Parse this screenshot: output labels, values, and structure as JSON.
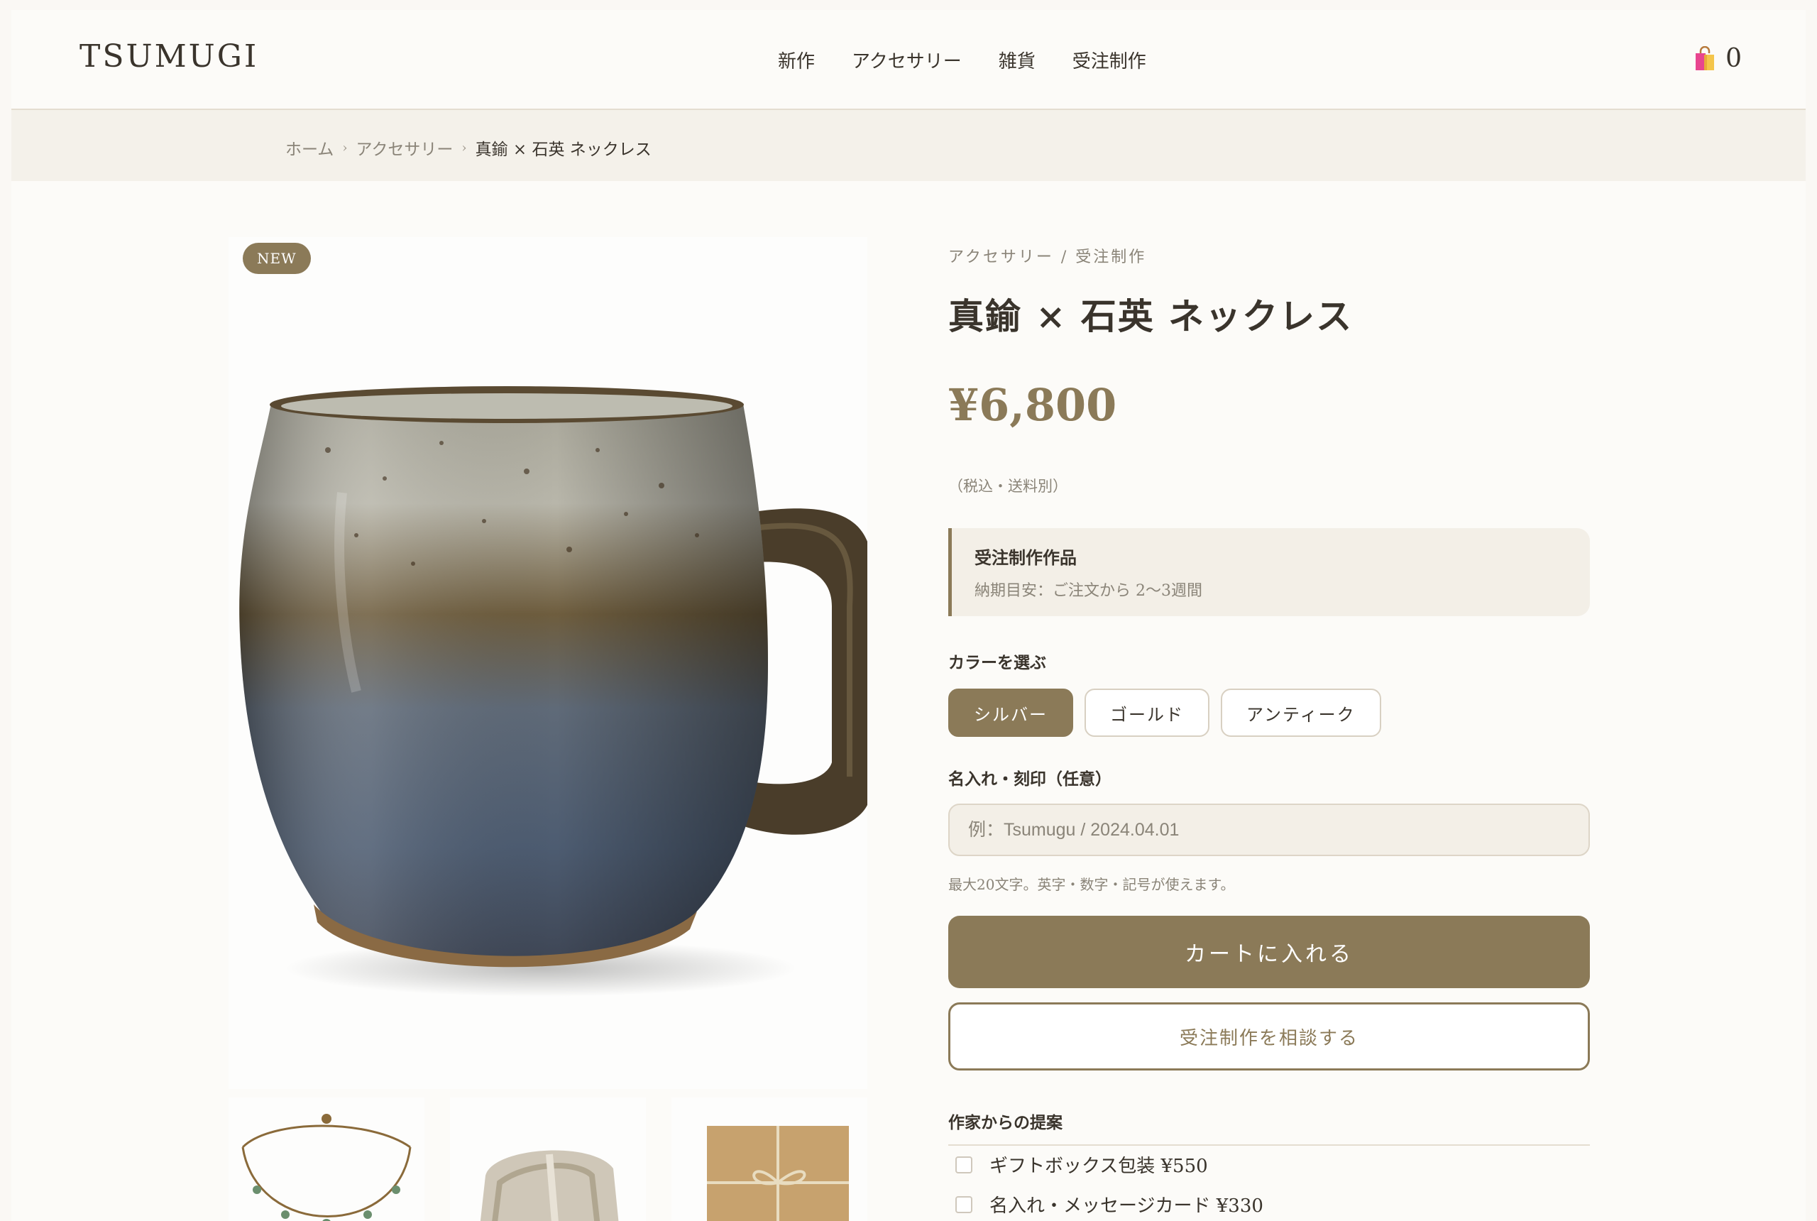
{
  "header": {
    "logo": "TSUMUGI",
    "nav": [
      "新作",
      "アクセサリー",
      "雑貨",
      "受注制作"
    ],
    "cart_count": "0"
  },
  "breadcrumb": {
    "items": [
      "ホーム",
      "アクセサリー",
      "真鍮 × 石英 ネックレス"
    ],
    "separator": "›"
  },
  "product": {
    "badge": "NEW",
    "category": "アクセサリー / 受注制作",
    "title": "真鍮 × 石英 ネックレス",
    "price": "¥6,800",
    "tax_note": "（税込・送料別）",
    "notice": {
      "title": "受注制作作品",
      "body": "納期目安：ご注文から 2〜3週間"
    },
    "color_label": "カラーを選ぶ",
    "colors": [
      {
        "label": "シルバー",
        "selected": true
      },
      {
        "label": "ゴールド",
        "selected": false
      },
      {
        "label": "アンティーク",
        "selected": false
      }
    ],
    "engrave_label": "名入れ・刻印（任意）",
    "engrave_placeholder": "例：Tsumugu / 2024.04.01",
    "engrave_hint": "最大20文字。英字・数字・記号が使えます。",
    "add_to_cart": "カートに入れる",
    "consult": "受注制作を相談する",
    "suggest_title": "作家からの提案",
    "addons": [
      {
        "label": "ギフトボックス包装 ¥550",
        "checked": false
      },
      {
        "label": "名入れ・メッセージカード ¥330",
        "checked": false
      }
    ]
  },
  "colors": {
    "accent": "#8b7a58",
    "background": "#fcfbf8",
    "breadcrumb_bg": "#f4f1ea",
    "text": "#3a342c",
    "muted": "#8a8478"
  },
  "icons": [
    "shopping-bag-icon"
  ]
}
